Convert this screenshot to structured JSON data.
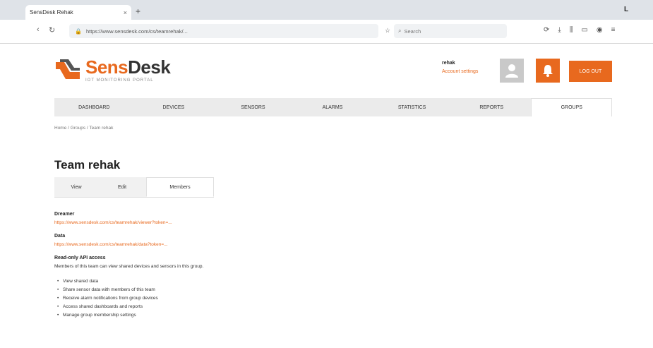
{
  "browser": {
    "tab_title": "SensDesk Rehak",
    "tab_close": "×",
    "new_tab": "+",
    "menu_glyph": "L",
    "back": "‹",
    "reload": "↻",
    "url": "https://www.sensdesk.com/cs/teamrehak/...",
    "search_placeholder": "Search"
  },
  "header": {
    "logo_sens": "Sens",
    "logo_desk": "Desk",
    "logo_tagline": "IOT MONITORING PORTAL",
    "user_name": "rehak",
    "user_link": "Account settings",
    "logout_label": "LOG OUT"
  },
  "mainnav": {
    "items": [
      {
        "label": "DASHBOARD"
      },
      {
        "label": "DEVICES"
      },
      {
        "label": "SENSORS"
      },
      {
        "label": "ALARMS"
      },
      {
        "label": "STATISTICS"
      },
      {
        "label": "REPORTS"
      },
      {
        "label": "GROUPS"
      }
    ]
  },
  "breadcrumb": "Home / Groups / Team rehak",
  "page": {
    "title": "Team rehak",
    "subtabs": [
      {
        "label": "View"
      },
      {
        "label": "Edit"
      },
      {
        "label": "Members"
      }
    ]
  },
  "content": {
    "field1_label": "Dreamer",
    "field1_link": "https://www.sensdesk.com/cs/teamrehak/viewer?token=...",
    "field2_label": "Data",
    "field2_link": "https://www.sensdesk.com/cs/teamrehak/data?token=...",
    "field3_label": "Read-only API access",
    "para": "Members of this team can view shared devices and sensors in this group.",
    "bullets": [
      "View shared data",
      "Share sensor data with members of this team",
      "Receive alarm notifications from group devices",
      "Access shared dashboards and reports",
      "Manage group membership settings"
    ]
  }
}
